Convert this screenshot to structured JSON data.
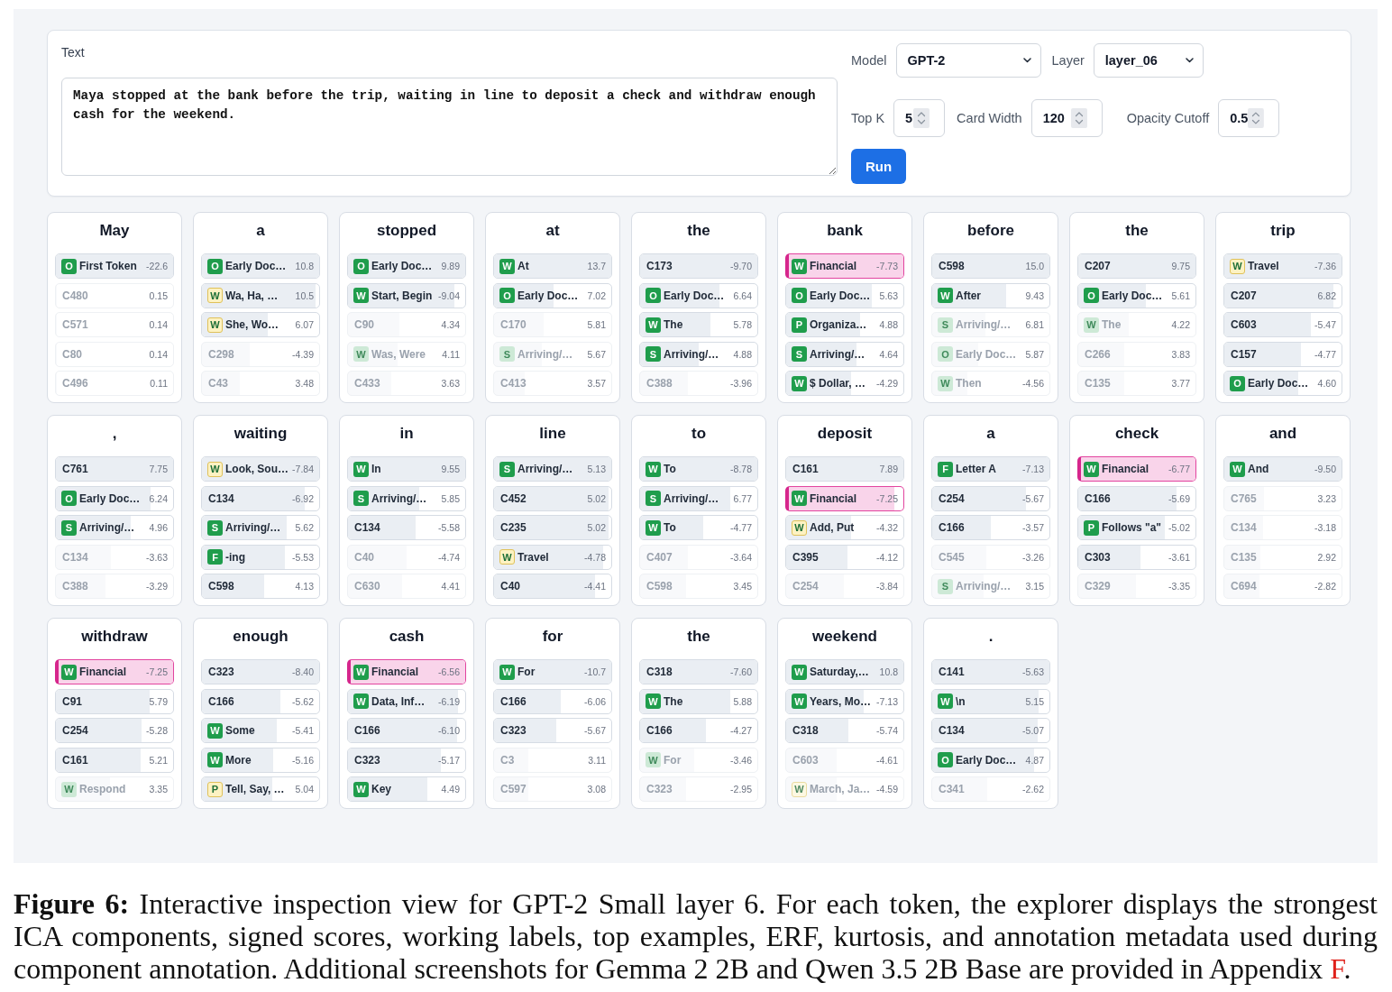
{
  "text_panel": {
    "label": "Text",
    "value": "Maya stopped at the bank before the trip, waiting in line to deposit a check and withdraw enough cash for the weekend."
  },
  "selects": [
    {
      "label": "Model",
      "value": "GPT-2"
    },
    {
      "label": "Layer",
      "value": "layer_06"
    }
  ],
  "number_inputs": [
    {
      "label": "Top K",
      "value": "5"
    },
    {
      "label": "Card Width",
      "value": "120"
    },
    {
      "label": "Opacity Cutoff",
      "value": "0.5"
    }
  ],
  "run_button": "Run",
  "cards": [
    {
      "token": "May",
      "entries": [
        {
          "tag": "O",
          "tag_outlined": false,
          "label": "First Token",
          "value": "-22.6",
          "level": 1,
          "faded": false,
          "highlighted": false
        },
        {
          "label": "C480",
          "value": "0.15",
          "level": 0.01,
          "faded": true,
          "highlighted": false
        },
        {
          "label": "C571",
          "value": "0.14",
          "level": 0.01,
          "faded": true,
          "highlighted": false
        },
        {
          "label": "C80",
          "value": "0.14",
          "level": 0.01,
          "faded": true,
          "highlighted": false
        },
        {
          "label": "C496",
          "value": "0.11",
          "level": 0.01,
          "faded": true,
          "highlighted": false
        }
      ]
    },
    {
      "token": "a",
      "entries": [
        {
          "tag": "O",
          "tag_outlined": false,
          "label": "Early Doc…",
          "value": "10.8",
          "level": 1,
          "faded": false,
          "highlighted": false
        },
        {
          "tag": "W",
          "tag_outlined": true,
          "label": "Wa, Ha, …",
          "value": "10.5",
          "level": 0.97,
          "faded": false,
          "highlighted": false
        },
        {
          "tag": "W",
          "tag_outlined": true,
          "label": "She, Wo…",
          "value": "6.07",
          "level": 0.56,
          "faded": false,
          "highlighted": false
        },
        {
          "label": "C298",
          "value": "-4.39",
          "level": 0.41,
          "faded": true,
          "highlighted": false
        },
        {
          "label": "C43",
          "value": "3.48",
          "level": 0.32,
          "faded": true,
          "highlighted": false
        }
      ]
    },
    {
      "token": "stopped",
      "entries": [
        {
          "tag": "O",
          "tag_outlined": false,
          "label": "Early Doc…",
          "value": "9.89",
          "level": 1,
          "faded": false,
          "highlighted": false
        },
        {
          "tag": "W",
          "tag_outlined": false,
          "label": "Start, Begin",
          "value": "-9.04",
          "level": 0.91,
          "faded": false,
          "highlighted": false
        },
        {
          "label": "C90",
          "value": "4.34",
          "level": 0.44,
          "faded": true,
          "highlighted": false
        },
        {
          "tag": "W",
          "tag_outlined": false,
          "label": "Was, Were",
          "value": "4.11",
          "level": 0.42,
          "faded": true,
          "highlighted": false
        },
        {
          "label": "C433",
          "value": "3.63",
          "level": 0.37,
          "faded": true,
          "highlighted": false
        }
      ]
    },
    {
      "token": "at",
      "entries": [
        {
          "tag": "W",
          "tag_outlined": false,
          "label": "At",
          "value": "13.7",
          "level": 1,
          "faded": false,
          "highlighted": false
        },
        {
          "tag": "O",
          "tag_outlined": false,
          "label": "Early Doc…",
          "value": "7.02",
          "level": 0.51,
          "faded": false,
          "highlighted": false
        },
        {
          "label": "C170",
          "value": "5.81",
          "level": 0.42,
          "faded": true,
          "highlighted": false
        },
        {
          "tag": "S",
          "tag_outlined": false,
          "label": "Arriving/…",
          "value": "5.67",
          "level": 0.41,
          "faded": true,
          "highlighted": false
        },
        {
          "label": "C413",
          "value": "3.57",
          "level": 0.26,
          "faded": true,
          "highlighted": false
        }
      ]
    },
    {
      "token": "the",
      "entries": [
        {
          "label": "C173",
          "value": "-9.70",
          "level": 1,
          "faded": false,
          "highlighted": false
        },
        {
          "tag": "O",
          "tag_outlined": false,
          "label": "Early Doc…",
          "value": "6.64",
          "level": 0.68,
          "faded": false,
          "highlighted": false
        },
        {
          "tag": "W",
          "tag_outlined": false,
          "label": "The",
          "value": "5.78",
          "level": 0.6,
          "faded": false,
          "highlighted": false
        },
        {
          "tag": "S",
          "tag_outlined": false,
          "label": "Arriving/…",
          "value": "4.88",
          "level": 0.5,
          "faded": false,
          "highlighted": false
        },
        {
          "label": "C388",
          "value": "-3.96",
          "level": 0.41,
          "faded": true,
          "highlighted": false
        }
      ]
    },
    {
      "token": "bank",
      "entries": [
        {
          "tag": "W",
          "tag_outlined": false,
          "label": "Financial",
          "value": "-7.73",
          "level": 1,
          "faded": false,
          "highlighted": true
        },
        {
          "tag": "O",
          "tag_outlined": false,
          "label": "Early Doc…",
          "value": "5.63",
          "level": 0.73,
          "faded": false,
          "highlighted": false
        },
        {
          "tag": "P",
          "tag_outlined": false,
          "label": "Organiza…",
          "value": "4.88",
          "level": 0.63,
          "faded": false,
          "highlighted": false
        },
        {
          "tag": "S",
          "tag_outlined": false,
          "label": "Arriving/…",
          "value": "4.64",
          "level": 0.6,
          "faded": false,
          "highlighted": false
        },
        {
          "tag": "W",
          "tag_outlined": false,
          "label": "$ Dollar, …",
          "value": "-4.29",
          "level": 0.55,
          "faded": false,
          "highlighted": false
        }
      ]
    },
    {
      "token": "before",
      "entries": [
        {
          "label": "C598",
          "value": "15.0",
          "level": 1,
          "faded": false,
          "highlighted": false
        },
        {
          "tag": "W",
          "tag_outlined": false,
          "label": "After",
          "value": "9.43",
          "level": 0.63,
          "faded": false,
          "highlighted": false
        },
        {
          "tag": "S",
          "tag_outlined": false,
          "label": "Arriving/…",
          "value": "6.81",
          "level": 0.45,
          "faded": true,
          "highlighted": false
        },
        {
          "tag": "O",
          "tag_outlined": false,
          "label": "Early Doc…",
          "value": "5.87",
          "level": 0.39,
          "faded": true,
          "highlighted": false
        },
        {
          "tag": "W",
          "tag_outlined": false,
          "label": "Then",
          "value": "-4.56",
          "level": 0.3,
          "faded": true,
          "highlighted": false
        }
      ]
    },
    {
      "token": "the",
      "entries": [
        {
          "label": "C207",
          "value": "9.75",
          "level": 1,
          "faded": false,
          "highlighted": false
        },
        {
          "tag": "O",
          "tag_outlined": false,
          "label": "Early Doc…",
          "value": "5.61",
          "level": 0.58,
          "faded": false,
          "highlighted": false
        },
        {
          "tag": "W",
          "tag_outlined": false,
          "label": "The",
          "value": "4.22",
          "level": 0.43,
          "faded": true,
          "highlighted": false
        },
        {
          "label": "C266",
          "value": "3.83",
          "level": 0.39,
          "faded": true,
          "highlighted": false
        },
        {
          "label": "C135",
          "value": "3.77",
          "level": 0.39,
          "faded": true,
          "highlighted": false
        }
      ]
    },
    {
      "token": "trip",
      "entries": [
        {
          "tag": "W",
          "tag_outlined": true,
          "label": "Travel",
          "value": "-7.36",
          "level": 1,
          "faded": false,
          "highlighted": false
        },
        {
          "label": "C207",
          "value": "6.82",
          "level": 0.93,
          "faded": false,
          "highlighted": false
        },
        {
          "label": "C603",
          "value": "-5.47",
          "level": 0.74,
          "faded": false,
          "highlighted": false
        },
        {
          "label": "C157",
          "value": "-4.77",
          "level": 0.65,
          "faded": false,
          "highlighted": false
        },
        {
          "tag": "O",
          "tag_outlined": false,
          "label": "Early Doc…",
          "value": "4.60",
          "level": 0.63,
          "faded": false,
          "highlighted": false
        }
      ]
    },
    {
      "token": ",",
      "entries": [
        {
          "label": "C761",
          "value": "7.75",
          "level": 1,
          "faded": false,
          "highlighted": false
        },
        {
          "tag": "O",
          "tag_outlined": false,
          "label": "Early Doc…",
          "value": "6.24",
          "level": 0.81,
          "faded": false,
          "highlighted": false
        },
        {
          "tag": "S",
          "tag_outlined": false,
          "label": "Arriving/…",
          "value": "4.96",
          "level": 0.64,
          "faded": false,
          "highlighted": false
        },
        {
          "label": "C134",
          "value": "-3.63",
          "level": 0.47,
          "faded": true,
          "highlighted": false
        },
        {
          "label": "C388",
          "value": "-3.29",
          "level": 0.42,
          "faded": true,
          "highlighted": false
        }
      ]
    },
    {
      "token": "waiting",
      "entries": [
        {
          "tag": "W",
          "tag_outlined": true,
          "label": "Look, Sou…",
          "value": "-7.84",
          "level": 1,
          "faded": false,
          "highlighted": false
        },
        {
          "label": "C134",
          "value": "-6.92",
          "level": 0.88,
          "faded": false,
          "highlighted": false
        },
        {
          "tag": "S",
          "tag_outlined": false,
          "label": "Arriving/…",
          "value": "5.62",
          "level": 0.72,
          "faded": false,
          "highlighted": false
        },
        {
          "tag": "F",
          "tag_outlined": false,
          "label": "-ing",
          "value": "-5.53",
          "level": 0.71,
          "faded": false,
          "highlighted": false
        },
        {
          "label": "C598",
          "value": "4.13",
          "level": 0.53,
          "faded": false,
          "highlighted": false
        }
      ]
    },
    {
      "token": "in",
      "entries": [
        {
          "tag": "W",
          "tag_outlined": false,
          "label": "In",
          "value": "9.55",
          "level": 1,
          "faded": false,
          "highlighted": false
        },
        {
          "tag": "S",
          "tag_outlined": false,
          "label": "Arriving/…",
          "value": "5.85",
          "level": 0.61,
          "faded": false,
          "highlighted": false
        },
        {
          "label": "C134",
          "value": "-5.58",
          "level": 0.58,
          "faded": false,
          "highlighted": false
        },
        {
          "label": "C40",
          "value": "-4.74",
          "level": 0.5,
          "faded": true,
          "highlighted": false
        },
        {
          "label": "C630",
          "value": "4.41",
          "level": 0.46,
          "faded": true,
          "highlighted": false
        }
      ]
    },
    {
      "token": "line",
      "entries": [
        {
          "tag": "S",
          "tag_outlined": false,
          "label": "Arriving/…",
          "value": "5.13",
          "level": 1,
          "faded": false,
          "highlighted": false
        },
        {
          "label": "C452",
          "value": "5.02",
          "level": 0.98,
          "faded": false,
          "highlighted": false
        },
        {
          "label": "C235",
          "value": "5.02",
          "level": 0.98,
          "faded": false,
          "highlighted": false
        },
        {
          "tag": "W",
          "tag_outlined": true,
          "label": "Travel",
          "value": "-4.78",
          "level": 0.93,
          "faded": false,
          "highlighted": false
        },
        {
          "label": "C40",
          "value": "-4.41",
          "level": 0.86,
          "faded": false,
          "highlighted": false
        }
      ]
    },
    {
      "token": "to",
      "entries": [
        {
          "tag": "W",
          "tag_outlined": false,
          "label": "To",
          "value": "-8.78",
          "level": 1,
          "faded": false,
          "highlighted": false
        },
        {
          "tag": "S",
          "tag_outlined": false,
          "label": "Arriving/…",
          "value": "6.77",
          "level": 0.77,
          "faded": false,
          "highlighted": false
        },
        {
          "tag": "W",
          "tag_outlined": false,
          "label": "To",
          "value": "-4.77",
          "level": 0.54,
          "faded": false,
          "highlighted": false
        },
        {
          "label": "C407",
          "value": "-3.64",
          "level": 0.41,
          "faded": true,
          "highlighted": false
        },
        {
          "label": "C598",
          "value": "3.45",
          "level": 0.39,
          "faded": true,
          "highlighted": false
        }
      ]
    },
    {
      "token": "deposit",
      "entries": [
        {
          "label": "C161",
          "value": "7.89",
          "level": 1,
          "faded": false,
          "highlighted": false
        },
        {
          "tag": "W",
          "tag_outlined": false,
          "label": "Financial",
          "value": "-7.25",
          "level": 0.92,
          "faded": false,
          "highlighted": true
        },
        {
          "tag": "W",
          "tag_outlined": true,
          "label": "Add, Put",
          "value": "-4.32",
          "level": 0.55,
          "faded": false,
          "highlighted": false
        },
        {
          "label": "C395",
          "value": "-4.12",
          "level": 0.52,
          "faded": false,
          "highlighted": false
        },
        {
          "label": "C254",
          "value": "-3.84",
          "level": 0.49,
          "faded": true,
          "highlighted": false
        }
      ]
    },
    {
      "token": "a",
      "entries": [
        {
          "tag": "F",
          "tag_outlined": false,
          "label": "Letter A",
          "value": "-7.13",
          "level": 1,
          "faded": false,
          "highlighted": false
        },
        {
          "label": "C254",
          "value": "-5.67",
          "level": 0.8,
          "faded": false,
          "highlighted": false
        },
        {
          "label": "C166",
          "value": "-3.57",
          "level": 0.5,
          "faded": false,
          "highlighted": false
        },
        {
          "label": "C545",
          "value": "-3.26",
          "level": 0.46,
          "faded": true,
          "highlighted": false
        },
        {
          "tag": "S",
          "tag_outlined": false,
          "label": "Arriving/…",
          "value": "3.15",
          "level": 0.44,
          "faded": true,
          "highlighted": false
        }
      ]
    },
    {
      "token": "check",
      "entries": [
        {
          "tag": "W",
          "tag_outlined": false,
          "label": "Financial",
          "value": "-6.77",
          "level": 1,
          "faded": false,
          "highlighted": true
        },
        {
          "label": "C166",
          "value": "-5.69",
          "level": 0.84,
          "faded": false,
          "highlighted": false
        },
        {
          "tag": "P",
          "tag_outlined": false,
          "label": "Follows \"a\"",
          "value": "-5.02",
          "level": 0.74,
          "faded": false,
          "highlighted": false
        },
        {
          "label": "C303",
          "value": "-3.61",
          "level": 0.53,
          "faded": false,
          "highlighted": false
        },
        {
          "label": "C329",
          "value": "-3.35",
          "level": 0.49,
          "faded": true,
          "highlighted": false
        }
      ]
    },
    {
      "token": "and",
      "entries": [
        {
          "tag": "W",
          "tag_outlined": false,
          "label": "And",
          "value": "-9.50",
          "level": 1,
          "faded": false,
          "highlighted": false
        },
        {
          "label": "C765",
          "value": "3.23",
          "level": 0.34,
          "faded": true,
          "highlighted": false
        },
        {
          "label": "C134",
          "value": "-3.18",
          "level": 0.33,
          "faded": true,
          "highlighted": false
        },
        {
          "label": "C135",
          "value": "2.92",
          "level": 0.31,
          "faded": true,
          "highlighted": false
        },
        {
          "label": "C694",
          "value": "-2.82",
          "level": 0.3,
          "faded": true,
          "highlighted": false
        }
      ]
    },
    {
      "token": "withdraw",
      "entries": [
        {
          "tag": "W",
          "tag_outlined": false,
          "label": "Financial",
          "value": "-7.25",
          "level": 1,
          "faded": false,
          "highlighted": true
        },
        {
          "label": "C91",
          "value": "5.79",
          "level": 0.8,
          "faded": false,
          "highlighted": false
        },
        {
          "label": "C254",
          "value": "-5.28",
          "level": 0.73,
          "faded": false,
          "highlighted": false
        },
        {
          "label": "C161",
          "value": "5.21",
          "level": 0.72,
          "faded": false,
          "highlighted": false
        },
        {
          "tag": "W",
          "tag_outlined": false,
          "label": "Respond",
          "value": "3.35",
          "level": 0.46,
          "faded": true,
          "highlighted": false
        }
      ]
    },
    {
      "token": "enough",
      "entries": [
        {
          "label": "C323",
          "value": "-8.40",
          "level": 1,
          "faded": false,
          "highlighted": false
        },
        {
          "label": "C166",
          "value": "-5.62",
          "level": 0.67,
          "faded": false,
          "highlighted": false
        },
        {
          "tag": "W",
          "tag_outlined": false,
          "label": "Some",
          "value": "-5.41",
          "level": 0.64,
          "faded": false,
          "highlighted": false
        },
        {
          "tag": "W",
          "tag_outlined": false,
          "label": "More",
          "value": "-5.16",
          "level": 0.61,
          "faded": false,
          "highlighted": false
        },
        {
          "tag": "P",
          "tag_outlined": true,
          "label": "Tell, Say, …",
          "value": "5.04",
          "level": 0.6,
          "faded": false,
          "highlighted": false
        }
      ]
    },
    {
      "token": "cash",
      "entries": [
        {
          "tag": "W",
          "tag_outlined": false,
          "label": "Financial",
          "value": "-6.56",
          "level": 1,
          "faded": false,
          "highlighted": true
        },
        {
          "tag": "W",
          "tag_outlined": false,
          "label": "Data, Inf…",
          "value": "-6.19",
          "level": 0.94,
          "faded": false,
          "highlighted": false
        },
        {
          "label": "C166",
          "value": "-6.10",
          "level": 0.93,
          "faded": false,
          "highlighted": false
        },
        {
          "label": "C323",
          "value": "-5.17",
          "level": 0.79,
          "faded": false,
          "highlighted": false
        },
        {
          "tag": "W",
          "tag_outlined": false,
          "label": "Key",
          "value": "4.49",
          "level": 0.68,
          "faded": false,
          "highlighted": false
        }
      ]
    },
    {
      "token": "for",
      "entries": [
        {
          "tag": "W",
          "tag_outlined": false,
          "label": "For",
          "value": "-10.7",
          "level": 1,
          "faded": false,
          "highlighted": false
        },
        {
          "label": "C166",
          "value": "-6.06",
          "level": 0.57,
          "faded": false,
          "highlighted": false
        },
        {
          "label": "C323",
          "value": "-5.67",
          "level": 0.53,
          "faded": false,
          "highlighted": false
        },
        {
          "label": "C3",
          "value": "3.11",
          "level": 0.29,
          "faded": true,
          "highlighted": false
        },
        {
          "label": "C597",
          "value": "3.08",
          "level": 0.29,
          "faded": true,
          "highlighted": false
        }
      ]
    },
    {
      "token": "the",
      "entries": [
        {
          "label": "C318",
          "value": "-7.60",
          "level": 1,
          "faded": false,
          "highlighted": false
        },
        {
          "tag": "W",
          "tag_outlined": false,
          "label": "The",
          "value": "5.88",
          "level": 0.77,
          "faded": false,
          "highlighted": false
        },
        {
          "label": "C166",
          "value": "-4.27",
          "level": 0.56,
          "faded": false,
          "highlighted": false
        },
        {
          "tag": "W",
          "tag_outlined": false,
          "label": "For",
          "value": "-3.46",
          "level": 0.46,
          "faded": true,
          "highlighted": false
        },
        {
          "label": "C323",
          "value": "-2.95",
          "level": 0.39,
          "faded": true,
          "highlighted": false
        }
      ]
    },
    {
      "token": "weekend",
      "entries": [
        {
          "tag": "W",
          "tag_outlined": false,
          "label": "Saturday,…",
          "value": "10.8",
          "level": 1,
          "faded": false,
          "highlighted": false
        },
        {
          "tag": "W",
          "tag_outlined": false,
          "label": "Years, Mo…",
          "value": "-7.13",
          "level": 0.66,
          "faded": false,
          "highlighted": false
        },
        {
          "label": "C318",
          "value": "-5.74",
          "level": 0.53,
          "faded": false,
          "highlighted": false
        },
        {
          "label": "C603",
          "value": "-4.61",
          "level": 0.43,
          "faded": true,
          "highlighted": false
        },
        {
          "tag": "W",
          "tag_outlined": true,
          "label": "March, Ja…",
          "value": "-4.59",
          "level": 0.43,
          "faded": true,
          "highlighted": false
        }
      ]
    },
    {
      "token": ".",
      "entries": [
        {
          "label": "C141",
          "value": "-5.63",
          "level": 1,
          "faded": false,
          "highlighted": false
        },
        {
          "tag": "W",
          "tag_outlined": false,
          "label": "\\n",
          "value": "5.15",
          "level": 0.91,
          "faded": false,
          "highlighted": false
        },
        {
          "label": "C134",
          "value": "-5.07",
          "level": 0.9,
          "faded": false,
          "highlighted": false
        },
        {
          "tag": "O",
          "tag_outlined": false,
          "label": "Early Doc…",
          "value": "4.87",
          "level": 0.87,
          "faded": false,
          "highlighted": false
        },
        {
          "label": "C341",
          "value": "-2.62",
          "level": 0.47,
          "faded": true,
          "highlighted": false
        }
      ]
    }
  ],
  "caption": {
    "label": "Figure 6:",
    "text": "Interactive inspection view for GPT-2 Small layer 6. For each token, the explorer displays the strongest ICA components, signed scores, working labels, top examples, ERF, kurtosis, and annotation metadata used during component annotation. Additional screenshots for Gemma 2 2B and Qwen 3.5 2B Base are provided in Appendix",
    "link": "F",
    "tail": "."
  }
}
